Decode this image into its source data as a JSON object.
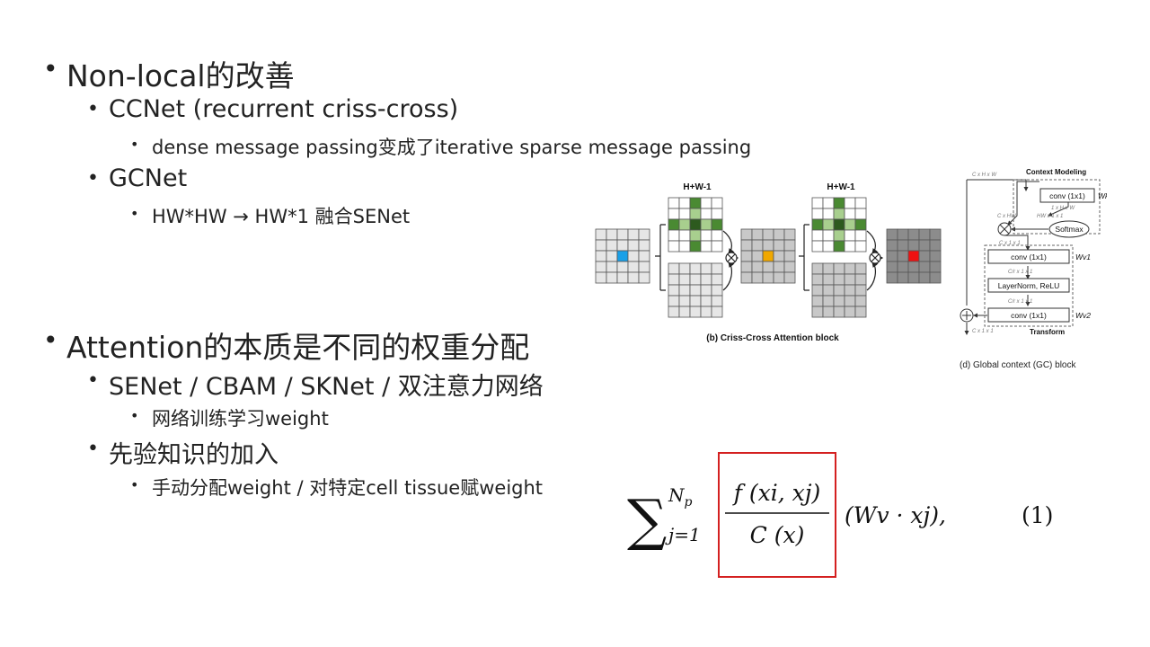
{
  "outline": {
    "nonlocal_heading": "Non-local的改善",
    "ccnet": "CCNet (recurrent criss-cross)",
    "ccnet_detail": "dense message passing变成了iterative sparse message passing",
    "gcnet": "GCNet",
    "gcnet_detail": "HW*HW → HW*1 融合SENet",
    "attention_heading": "Attention的本质是不同的权重分配",
    "attention_methods": "SENet / CBAM / SKNet / 双注意力网络",
    "attention_detail": "网络训练学习weight",
    "prior_heading": "先验知识的加入",
    "prior_detail": "手动分配weight / 对特定cell tissue赋weight"
  },
  "criss_cross_figure": {
    "label_left": "H+W-1",
    "label_right": "H+W-1",
    "caption": "(b) Criss-Cross Attention block",
    "colors": {
      "input_grid": "#e6e6e6",
      "query_cell": "#1aa0e8",
      "attn_light": "#a8cf8e",
      "attn_dark": "#4a8a32",
      "attn_center": "#2d5a1e",
      "mid_grid": "#c8c8c8",
      "mid_cell": "#f0a800",
      "out_grid": "#8c8c8c",
      "out_cell": "#ee1111"
    }
  },
  "gc_figure": {
    "dims_top": "C x H x W",
    "title": "Context Modeling",
    "conv_k": "conv (1x1)",
    "wk": "Wk",
    "dims_1hw": "1 x H x W",
    "dims_chw": "C x HW",
    "dims_hw11": "HW x 1 x 1",
    "softmax": "Softmax",
    "dims_c11_a": "C x 1 x 1",
    "conv_v1": "conv (1x1)",
    "wv1": "Wv1",
    "dims_cr11_a": "C/r x 1 x 1",
    "layernorm": "LayerNorm, ReLU",
    "dims_cr11_b": "C/r x 1 x 1",
    "conv_v2": "conv (1x1)",
    "wv2": "Wv2",
    "dims_c11_b": "C x 1 x 1",
    "transform": "Transform",
    "caption": "(d) Global context (GC) block"
  },
  "formula": {
    "sum_symbol": "∑",
    "upper": "N",
    "upper_sub": "p",
    "lower": "j=1",
    "numerator": "f (xi, xj)",
    "denominator": "C (x)",
    "tail": "(Wv · xj),",
    "eq_number": "(1)",
    "box_color": "#d42020"
  }
}
